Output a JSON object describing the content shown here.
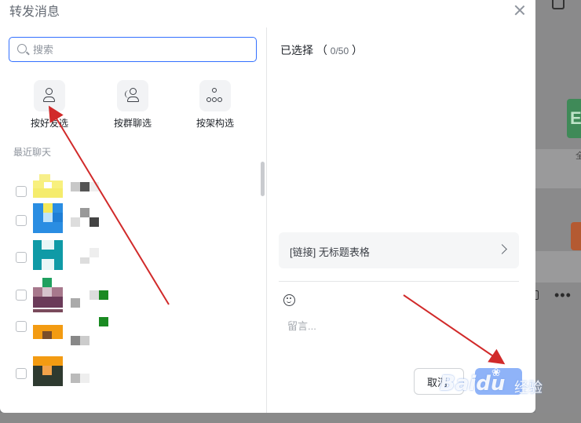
{
  "dialog": {
    "title": "转发消息",
    "search_placeholder": "搜索",
    "filters": [
      {
        "label": "按好友选",
        "icon": "person-icon"
      },
      {
        "label": "按群聊选",
        "icon": "group-icon"
      },
      {
        "label": "按架构选",
        "icon": "org-chart-icon"
      }
    ],
    "recent_label": "最近聊天",
    "selected": {
      "label": "已选择",
      "open": "（",
      "count": "0/50",
      "close": "）"
    },
    "link_card": {
      "text": "[链接] 无标题表格"
    },
    "message_placeholder": "留言...",
    "cancel_label": "取消",
    "send_label": ""
  },
  "background": {
    "green_tile_letter": "E",
    "tiny_text": "全"
  },
  "watermark": {
    "text": "Baidu",
    "cn": "经验"
  },
  "colors": {
    "accent": "#3370ff",
    "annotation_arrow": "#d12a2a",
    "send_button": "#8fb3f8"
  }
}
